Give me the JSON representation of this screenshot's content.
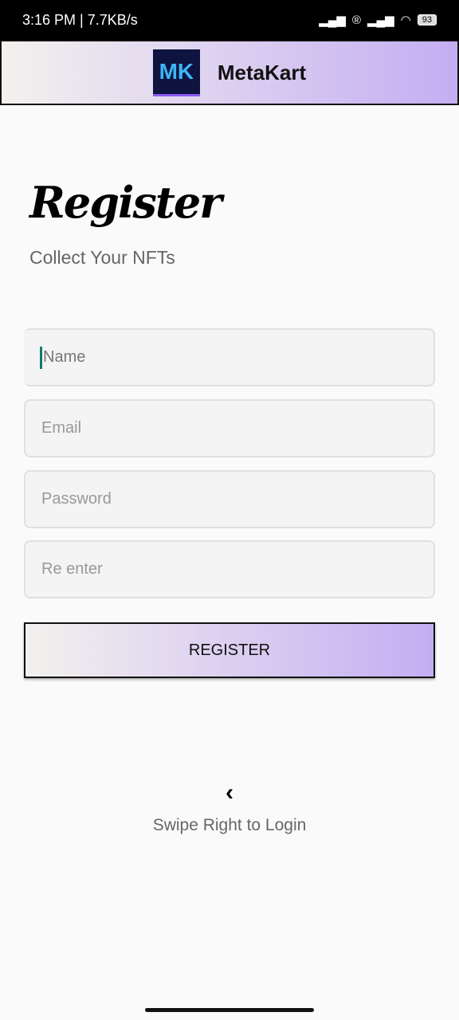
{
  "status": {
    "time": "3:16 PM | 7.7KB/s",
    "battery": "93"
  },
  "appbar": {
    "logo_text": "MK",
    "title": "MetaKart"
  },
  "page": {
    "title": "Register",
    "subtitle": "Collect Your NFTs"
  },
  "form": {
    "name_placeholder": "Name",
    "email_placeholder": "Email",
    "password_placeholder": "Password",
    "reenter_placeholder": "Re enter",
    "register_label": "REGISTER"
  },
  "footer": {
    "chevron": "‹",
    "swipe_text": "Swipe Right to Login"
  }
}
